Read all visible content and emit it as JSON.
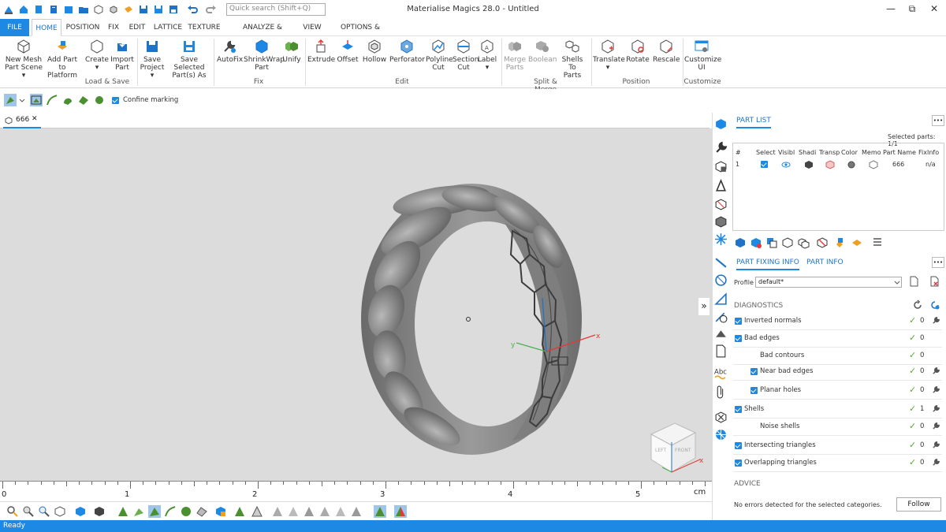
{
  "window": {
    "title": "Materialise Magics 28.0 - Untitled",
    "search_placeholder": "Quick search (Shift+Q)",
    "minimize": "—",
    "restore": "⧉",
    "close": "✕"
  },
  "tabs": [
    "FILE",
    "HOME",
    "POSITION",
    "FIX",
    "EDIT",
    "LATTICE",
    "TEXTURE",
    "ANALYZE & REPORT",
    "VIEW",
    "OPTIONS & HELP"
  ],
  "ribbon": {
    "buttons": [
      {
        "l1": "New Mesh",
        "l2": "Part Scene ▾"
      },
      {
        "l1": "Add Part to",
        "l2": "Platform"
      },
      {
        "l1": "Create",
        "l2": "▾"
      },
      {
        "l1": "Import",
        "l2": "Part"
      },
      {
        "l1": "Save",
        "l2": "Project ▾"
      },
      {
        "l1": "Save Selected",
        "l2": "Part(s) As"
      },
      {
        "l1": "AutoFix",
        "l2": ""
      },
      {
        "l1": "ShrinkWrap",
        "l2": "Part"
      },
      {
        "l1": "Unify",
        "l2": ""
      },
      {
        "l1": "Extrude",
        "l2": ""
      },
      {
        "l1": "Offset",
        "l2": ""
      },
      {
        "l1": "Hollow",
        "l2": ""
      },
      {
        "l1": "Perforator",
        "l2": ""
      },
      {
        "l1": "Polyline",
        "l2": "Cut"
      },
      {
        "l1": "Section",
        "l2": "Cut"
      },
      {
        "l1": "Label",
        "l2": "▾"
      },
      {
        "l1": "Merge",
        "l2": "Parts"
      },
      {
        "l1": "Boolean",
        "l2": ""
      },
      {
        "l1": "Shells To",
        "l2": "Parts"
      },
      {
        "l1": "Translate",
        "l2": "▾"
      },
      {
        "l1": "Rotate",
        "l2": ""
      },
      {
        "l1": "Rescale",
        "l2": ""
      },
      {
        "l1": "Customize",
        "l2": "UI"
      }
    ],
    "groups": [
      "Load & Save",
      "Fix",
      "Edit",
      "Split & Merge",
      "Position",
      "Customize"
    ]
  },
  "toolbar2": {
    "confine_label": "Confine marking"
  },
  "document_tab": {
    "name": "666",
    "close": "✕"
  },
  "ruler": {
    "ticks": [
      "0",
      "1",
      "2",
      "3",
      "4",
      "5"
    ],
    "unit": "cm"
  },
  "viewcube": {
    "front": "FRONT",
    "left": "LEFT"
  },
  "axes": {
    "x": "x",
    "y": "y"
  },
  "expander": "»",
  "part_list": {
    "tab": "PART LIST",
    "more": "•••",
    "selected_parts": "Selected parts:  1/1",
    "columns": [
      "#",
      "Select",
      "Visibl",
      "Shadi",
      "Transp",
      "Color",
      "Memo",
      "Part Name",
      "FixInfo"
    ],
    "row": {
      "num": "1",
      "name": "666",
      "fixinfo": "n/a"
    }
  },
  "fixing": {
    "tab_active": "PART FIXING INFO",
    "tab_other": "PART INFO",
    "more": "•••",
    "profile_label": "Profile",
    "profile_value": "default*",
    "diagnostics_title": "DIAGNOSTICS",
    "rows": [
      {
        "label": "Inverted normals",
        "count": "0",
        "check": true,
        "indent": 0,
        "tool": true
      },
      {
        "label": "Bad edges",
        "count": "0",
        "check": true,
        "indent": 0,
        "tool": false
      },
      {
        "label": "Bad contours",
        "count": "0",
        "check": false,
        "indent": 1,
        "tool": false
      },
      {
        "label": "Near bad edges",
        "count": "0",
        "check": true,
        "indent": 1,
        "tool": true
      },
      {
        "label": "Planar holes",
        "count": "0",
        "check": true,
        "indent": 1,
        "tool": true
      },
      {
        "label": "Shells",
        "count": "1",
        "check": true,
        "indent": 0,
        "tool": true
      },
      {
        "label": "Noise shells",
        "count": "0",
        "check": false,
        "indent": 1,
        "tool": true
      },
      {
        "label": "Intersecting triangles",
        "count": "0",
        "check": true,
        "indent": 0,
        "tool": true
      },
      {
        "label": "Overlapping triangles",
        "count": "0",
        "check": true,
        "indent": 0,
        "tool": true
      }
    ],
    "advice_title": "ADVICE",
    "advice_text": "No errors detected for the selected categories.",
    "follow_button": "Follow"
  },
  "status": "Ready",
  "colors": {
    "accent": "#1e88e5",
    "viewport": "#dcdcdc",
    "ok": "#5aa832"
  }
}
